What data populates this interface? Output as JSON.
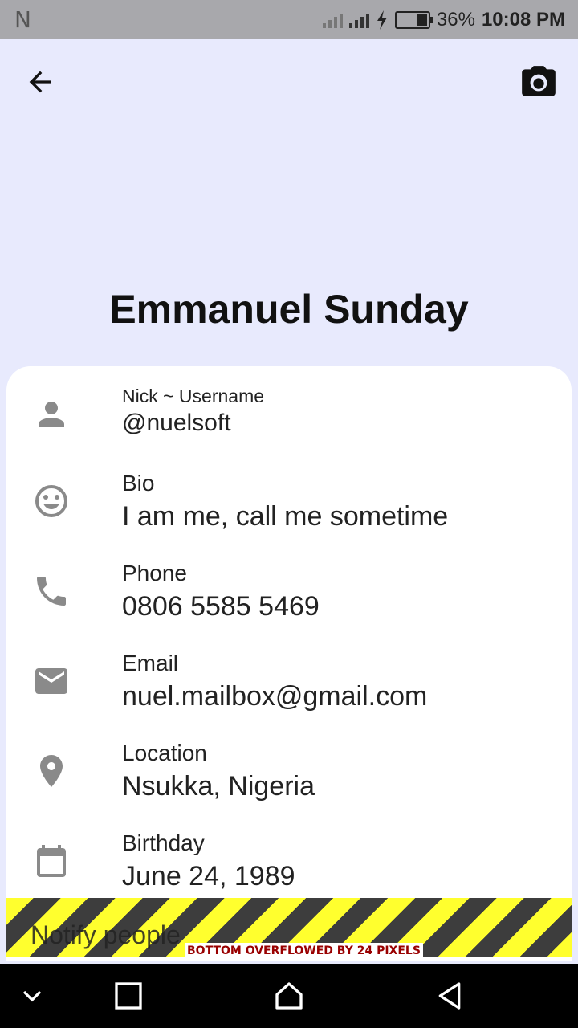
{
  "status_bar": {
    "carrier_glyph": "N",
    "battery_percent": "36%",
    "battery_level": 0.36,
    "time": "10:08 PM"
  },
  "app_bar": {
    "back_icon": "arrow-back-icon",
    "camera_icon": "camera-icon"
  },
  "profile": {
    "name": "Emmanuel Sunday"
  },
  "fields": [
    {
      "label": "Nick ~ Username",
      "value": "@nuelsoft",
      "icon": "person-icon"
    },
    {
      "label": "Bio",
      "value": "I am me, call me sometime",
      "icon": "smiley-icon"
    },
    {
      "label": "Phone",
      "value": "0806 5585 5469",
      "icon": "phone-icon"
    },
    {
      "label": "Email",
      "value": "nuel.mailbox@gmail.com",
      "icon": "email-icon"
    },
    {
      "label": "Location",
      "value": "Nsukka, Nigeria",
      "icon": "location-pin-icon"
    },
    {
      "label": "Birthday",
      "value": "June 24, 1989",
      "icon": "calendar-icon"
    }
  ],
  "overflow": {
    "behind_text": "Notify people",
    "message": "BOTTOM OVERFLOWED BY 24 PIXELS"
  },
  "colors": {
    "background": "#E8EAFD",
    "status_bar": "#A8A8AC",
    "icon_gray": "#8A8A8A",
    "warning_yellow": "#FFFF2E",
    "warning_dark": "#3D3D3D"
  }
}
